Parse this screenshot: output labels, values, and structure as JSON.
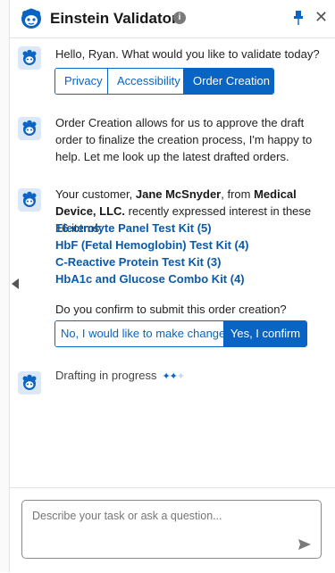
{
  "header": {
    "title": "Einstein Validator",
    "info_glyph": "i",
    "close_glyph": "✕"
  },
  "colors": {
    "accent": "#0a64c4",
    "link": "#0a5aa8"
  },
  "messages": {
    "greeting": "Hello, Ryan. What would you like to validate today?",
    "options": [
      "Privacy",
      "Accessibility",
      "Order Creation"
    ],
    "selected_option": "Order Creation",
    "explain": "Order Creation allows for us to approve the draft order to finalize the creation process, I'm happy to help. Let me look up the latest drafted orders.",
    "customer": {
      "prefix": "Your customer, ",
      "name": "Jane McSnyder",
      "middle": ", from ",
      "company": "Medical Device, LLC.",
      "suffix": " recently expressed interest in these 16 items:"
    },
    "items": [
      "Electrolyte Panel Test Kit (5)",
      "HbF (Fetal Hemoglobin) Test Kit (4)",
      "C-Reactive Protein Test Kit (3)",
      "HbA1c and Glucose Combo Kit (4)"
    ],
    "confirm_question": "Do you confirm to submit this order creation?",
    "confirm_no": "No, I would like to make changes",
    "confirm_yes": "Yes, I confirm",
    "status": "Drafting in progress"
  },
  "composer": {
    "placeholder": "Describe your task or ask a question..."
  },
  "icons": [
    "einstein-logo-icon",
    "info-icon",
    "pin-icon",
    "close-icon",
    "bot-avatar-icon",
    "sparkle-icon",
    "send-icon",
    "collapse-arrow-icon"
  ]
}
